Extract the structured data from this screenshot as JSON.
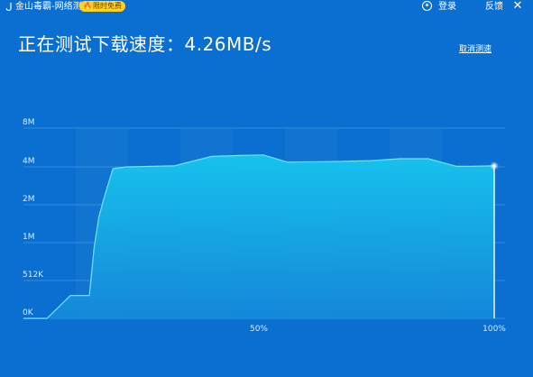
{
  "titlebar": {
    "app_title": "金山毒霸-网络测速",
    "badge": "限时免费",
    "login": "登录",
    "feedback": "反馈"
  },
  "speed": {
    "label": "正在测试下载速度：",
    "value": "4.26MB/s"
  },
  "cancel_label": "取消测速",
  "colors": {
    "background": "#0a6fd0",
    "area_top": "#17c6ee",
    "area_bottom": "#1588d9",
    "line": "#6ee3ff",
    "badge": "#ffd21f"
  },
  "chart_data": {
    "type": "area",
    "y_scale": "custom-stepped",
    "y_tick_labels": [
      "0K",
      "512K",
      "1M",
      "2M",
      "4M",
      "8M"
    ],
    "y_ticks": [
      0,
      512,
      1024,
      2048,
      4096,
      8192
    ],
    "x_tick_labels": [
      "50%",
      "100%"
    ],
    "x_ticks": [
      50,
      100
    ],
    "xlim": [
      0,
      100
    ],
    "grid": true,
    "series": [
      {
        "x": [
          0,
          5,
          10,
          14,
          15,
          16,
          17,
          19,
          22,
          32,
          40,
          46,
          51,
          56,
          65,
          74,
          80,
          86,
          92,
          95,
          100
        ],
        "y": [
          0,
          0,
          310,
          310,
          950,
          1700,
          2300,
          4000,
          4100,
          4200,
          5200,
          5300,
          5350,
          4600,
          4650,
          4750,
          4950,
          4950,
          4150,
          4150,
          4200
        ]
      }
    ]
  }
}
